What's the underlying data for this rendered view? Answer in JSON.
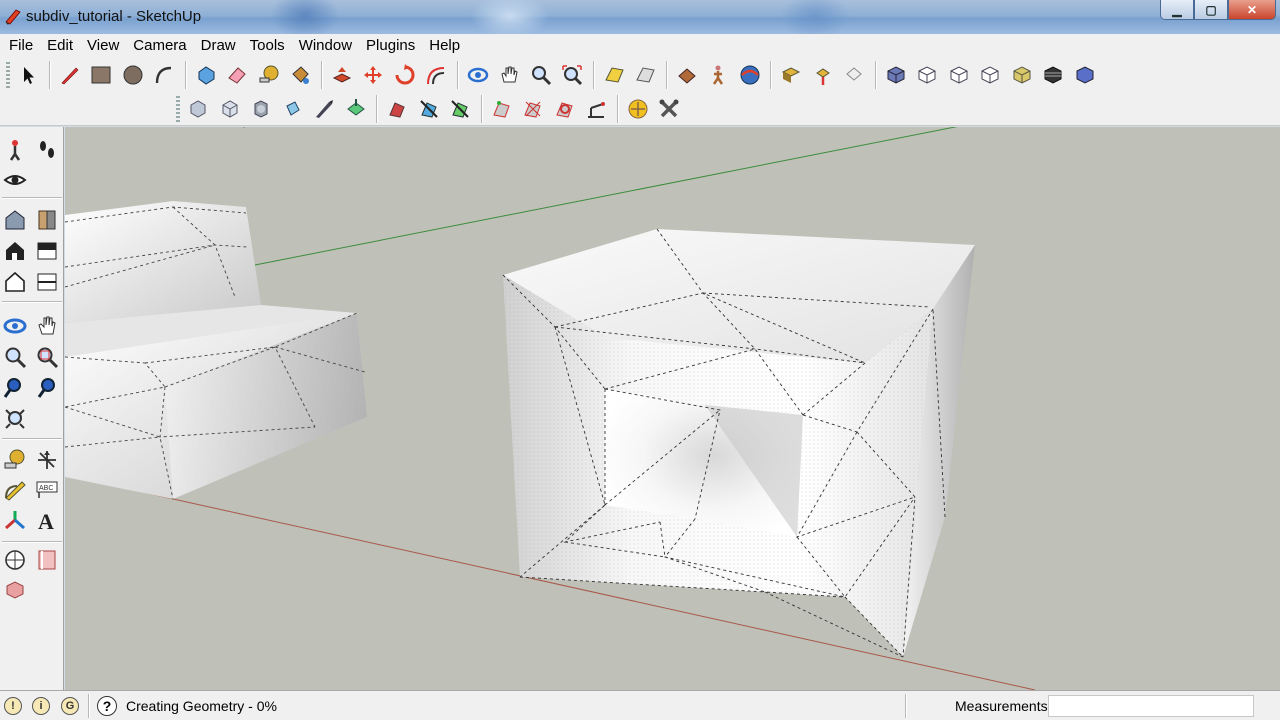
{
  "window": {
    "title": "subdiv_tutorial - SketchUp"
  },
  "menu": [
    "File",
    "Edit",
    "View",
    "Camera",
    "Draw",
    "Tools",
    "Window",
    "Plugins",
    "Help"
  ],
  "toolbar_main": [
    "select-icon",
    "line-icon",
    "rectangle-icon",
    "circle-icon",
    "arc-icon",
    "make-component-icon",
    "eraser-icon",
    "tape-measure-icon",
    "paint-bucket-icon",
    "push-pull-icon",
    "move-icon",
    "rotate-icon",
    "offset-icon",
    "orbit-icon",
    "pan-icon",
    "zoom-icon",
    "zoom-extents-icon",
    "previous-view-icon",
    "next-view-icon",
    "position-camera-icon",
    "walk-icon",
    "look-around-icon",
    "get-models-icon",
    "share-model-icon",
    "share-component-icon",
    "iso-view-icon",
    "top-view-icon",
    "front-view-icon",
    "right-view-icon",
    "back-view-icon",
    "left-view-icon",
    "bottom-view-icon"
  ],
  "toolbar_plugins": [
    "subdivide-icon",
    "subdivide-smooth-icon",
    "crease-icon",
    "extrude-face-icon",
    "knife-icon",
    "smooth-icon",
    "fredo-tool1-icon",
    "fredo-tool2-icon",
    "fredo-tool3-icon",
    "vertex-tool1-icon",
    "vertex-tool2-icon",
    "vertex-tool3-icon",
    "vertex-tool4-icon",
    "sun-icon",
    "tools-icon"
  ],
  "status": {
    "message": "Creating Geometry - 0%",
    "measurements_label": "Measurements",
    "measurements_value": ""
  },
  "colors": {
    "viewport_bg": "#bfc0b7",
    "green_axis": "#3c8c3c",
    "red_axis": "#a8584a"
  }
}
